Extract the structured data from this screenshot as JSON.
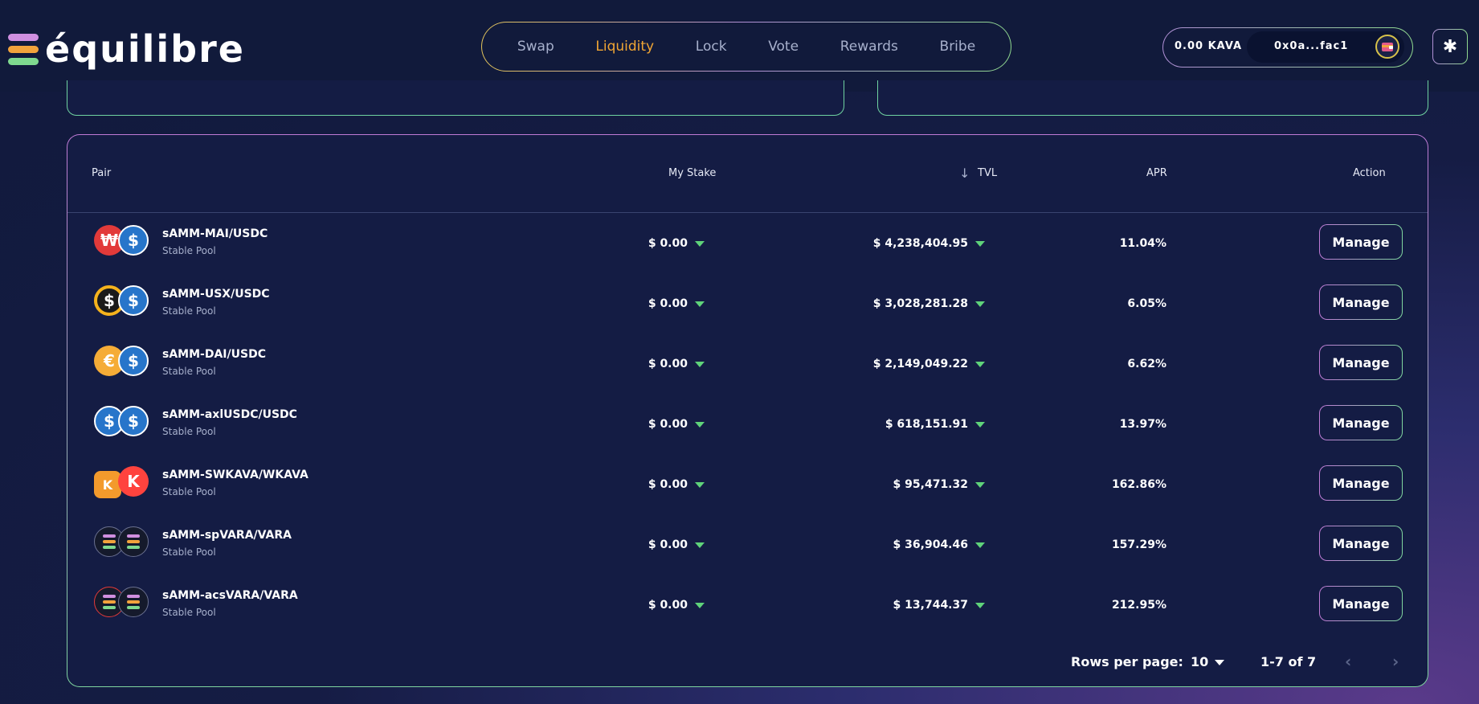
{
  "logo": {
    "text": "équilibre",
    "bar_colors": [
      "#d08fe0",
      "#f2a33c",
      "#7fd98f"
    ]
  },
  "nav": {
    "items": [
      "Swap",
      "Liquidity",
      "Lock",
      "Vote",
      "Rewards",
      "Bribe"
    ],
    "active": "Liquidity"
  },
  "wallet": {
    "balance": "0.00 KAVA",
    "address": "0x0a...fac1"
  },
  "table": {
    "headers": {
      "pair": "Pair",
      "stake": "My Stake",
      "tvl": "TVL",
      "apr": "APR",
      "action": "Action"
    },
    "sort": {
      "column": "TVL",
      "direction": "desc"
    },
    "rows": [
      {
        "name": "sAMM-MAI/USDC",
        "type": "Stable Pool",
        "stake": "$ 0.00",
        "tvl": "$ 4,238,404.95",
        "apr": "11.04%",
        "action": "Manage"
      },
      {
        "name": "sAMM-USX/USDC",
        "type": "Stable Pool",
        "stake": "$ 0.00",
        "tvl": "$ 3,028,281.28",
        "apr": "6.05%",
        "action": "Manage"
      },
      {
        "name": "sAMM-DAI/USDC",
        "type": "Stable Pool",
        "stake": "$ 0.00",
        "tvl": "$ 2,149,049.22",
        "apr": "6.62%",
        "action": "Manage"
      },
      {
        "name": "sAMM-axlUSDC/USDC",
        "type": "Stable Pool",
        "stake": "$ 0.00",
        "tvl": "$ 618,151.91",
        "apr": "13.97%",
        "action": "Manage"
      },
      {
        "name": "sAMM-SWKAVA/WKAVA",
        "type": "Stable Pool",
        "stake": "$ 0.00",
        "tvl": "$ 95,471.32",
        "apr": "162.86%",
        "action": "Manage"
      },
      {
        "name": "sAMM-spVARA/VARA",
        "type": "Stable Pool",
        "stake": "$ 0.00",
        "tvl": "$ 36,904.46",
        "apr": "157.29%",
        "action": "Manage"
      },
      {
        "name": "sAMM-acsVARA/VARA",
        "type": "Stable Pool",
        "stake": "$ 0.00",
        "tvl": "$ 13,744.37",
        "apr": "212.95%",
        "action": "Manage"
      }
    ]
  },
  "pagination": {
    "rows_label": "Rows per page:",
    "rows_value": "10",
    "range": "1-7 of 7"
  },
  "colors": {
    "accent_active": "#f0a534",
    "up_caret": "#5fd37a",
    "background": "#111a3b"
  }
}
